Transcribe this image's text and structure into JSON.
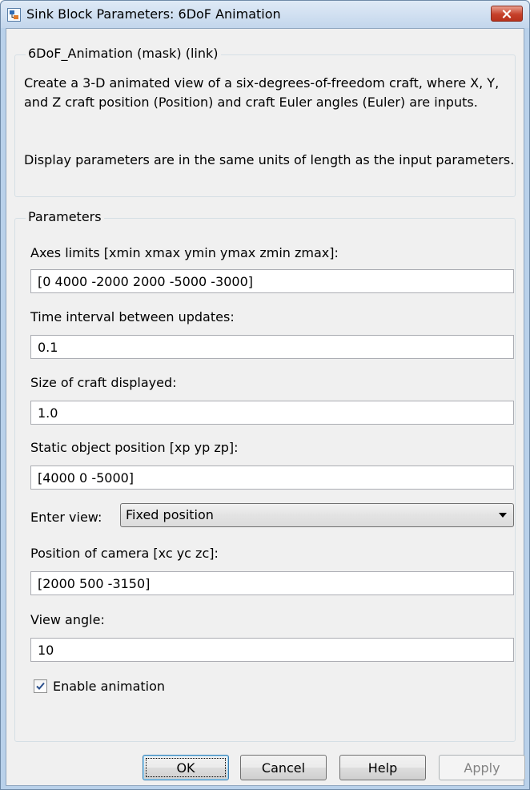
{
  "window": {
    "title": "Sink Block Parameters: 6DoF Animation"
  },
  "mask_group": {
    "title": "6DoF_Animation (mask) (link)",
    "description_1": "Create a 3-D animated view of a six-degrees-of-freedom craft, where X, Y, and Z craft position (Position) and craft Euler angles (Euler) are inputs.",
    "description_2": "Display parameters are in the same units of length as the input parameters."
  },
  "parameters": {
    "title": "Parameters",
    "axes_limits": {
      "label": "Axes limits [xmin xmax ymin ymax zmin zmax]:",
      "value": "[0 4000 -2000 2000 -5000 -3000]"
    },
    "time_interval": {
      "label": "Time interval between updates:",
      "value": "0.1"
    },
    "craft_size": {
      "label": "Size of craft displayed:",
      "value": "1.0"
    },
    "static_object": {
      "label": "Static object position [xp yp zp]:",
      "value": "[4000 0 -5000]"
    },
    "enter_view": {
      "label": "Enter view:",
      "selected": "Fixed position"
    },
    "camera_position": {
      "label": "Position of camera [xc yc zc]:",
      "value": "[2000 500 -3150]"
    },
    "view_angle": {
      "label": "View angle:",
      "value": "10"
    },
    "enable_animation": {
      "label": "Enable animation",
      "checked": true
    }
  },
  "buttons": {
    "ok": "OK",
    "cancel": "Cancel",
    "help": "Help",
    "apply": "Apply"
  },
  "icons": {
    "title": "simulink-block-icon",
    "close": "close-icon",
    "dropdown": "chevron-down-icon",
    "check": "checkmark-icon"
  },
  "colors": {
    "window_frame": "#b9d1ea",
    "client_bg": "#f0f0f0",
    "close_button": "#c6402a",
    "default_button_border": "#3c7fb1"
  }
}
